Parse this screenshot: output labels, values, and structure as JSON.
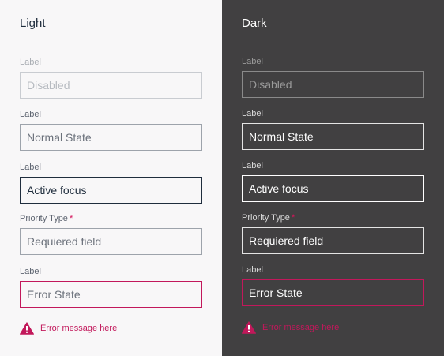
{
  "light": {
    "title": "Light",
    "disabled": {
      "label": "Label",
      "value": "Disabled"
    },
    "normal": {
      "label": "Label",
      "value": "Normal State"
    },
    "active": {
      "label": "Label",
      "value": "Active focus"
    },
    "required": {
      "label": "Priority Type",
      "star": "*",
      "value": "Requiered field"
    },
    "error": {
      "label": "Label",
      "value": "Error State",
      "message": "Error message here"
    }
  },
  "dark": {
    "title": "Dark",
    "disabled": {
      "label": "Label",
      "value": "Disabled"
    },
    "normal": {
      "label": "Label",
      "value": "Normal State"
    },
    "active": {
      "label": "Label",
      "value": "Active focus"
    },
    "required": {
      "label": "Priority Type",
      "star": "*",
      "value": "Requiered field"
    },
    "error": {
      "label": "Label",
      "value": "Error State",
      "message": "Error message here"
    }
  },
  "colors": {
    "light_bg": "#f8f7f8",
    "dark_bg": "#414041",
    "error": "#c2185b",
    "required_star": "#d4145a"
  }
}
